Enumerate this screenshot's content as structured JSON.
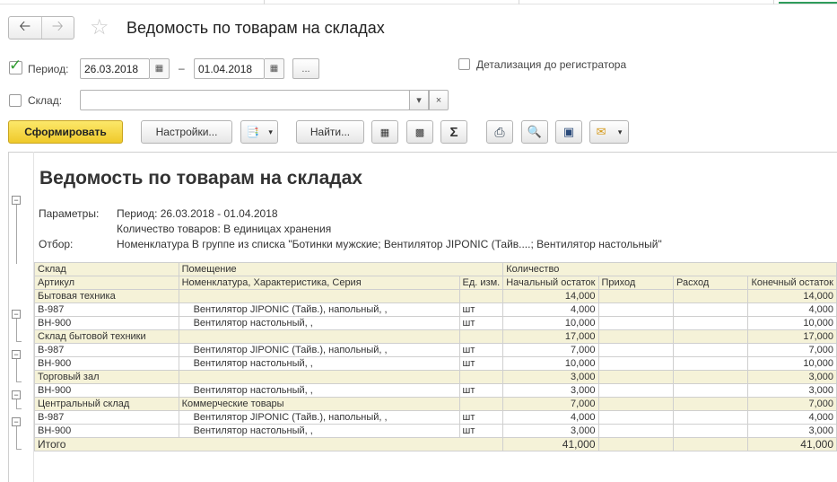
{
  "window": {
    "title": "Ведомость по товарам на складах",
    "back_icon": "arrow-left-icon",
    "forward_icon": "arrow-right-icon",
    "favorite_icon": "star-icon"
  },
  "filters": {
    "period_label": "Период:",
    "period_from": "26.03.2018",
    "period_dash": "–",
    "period_to": "01.04.2018",
    "period_more": "...",
    "detail_label": "Детализация до регистратора",
    "warehouse_label": "Склад:",
    "warehouse_value": ""
  },
  "toolbar": {
    "generate": "Сформировать",
    "settings": "Настройки...",
    "find": "Найти..."
  },
  "report": {
    "title": "Ведомость по товарам на складах",
    "params_label": "Параметры:",
    "params_line1": "Период: 26.03.2018 - 01.04.2018",
    "params_line2": "Количество товаров: В единицах хранения",
    "filter_label": "Отбор:",
    "filter_value": "Номенклатура В группе из списка \"Ботинки мужские; Вентилятор JIPONIC (Тайв....; Вентилятор настольный\"",
    "headers": {
      "warehouse": "Склад",
      "room": "Помещение",
      "quantity": "Количество",
      "article": "Артикул",
      "nomenclature": "Номенклатура, Характеристика, Серия",
      "unit": "Ед. изм.",
      "opening": "Начальный остаток",
      "income": "Приход",
      "expense": "Расход",
      "closing": "Конечный остаток"
    },
    "rows": [
      {
        "type": "group",
        "a": "Бытовая техника",
        "b": "",
        "c": "",
        "d": "14,000",
        "e": "",
        "f": "",
        "g": "14,000"
      },
      {
        "type": "item",
        "a": "В-987",
        "b": "Вентилятор JIPONIC (Тайв.), напольный, ,",
        "c": "шт",
        "d": "4,000",
        "e": "",
        "f": "",
        "g": "4,000"
      },
      {
        "type": "item",
        "a": "ВН-900",
        "b": "Вентилятор настольный, ,",
        "c": "шт",
        "d": "10,000",
        "e": "",
        "f": "",
        "g": "10,000"
      },
      {
        "type": "group",
        "a": "Склад бытовой техники",
        "b": "",
        "c": "",
        "d": "17,000",
        "e": "",
        "f": "",
        "g": "17,000"
      },
      {
        "type": "item",
        "a": "В-987",
        "b": "Вентилятор JIPONIC (Тайв.), напольный, ,",
        "c": "шт",
        "d": "7,000",
        "e": "",
        "f": "",
        "g": "7,000"
      },
      {
        "type": "item",
        "a": "ВН-900",
        "b": "Вентилятор настольный, ,",
        "c": "шт",
        "d": "10,000",
        "e": "",
        "f": "",
        "g": "10,000"
      },
      {
        "type": "group",
        "a": "Торговый зал",
        "b": "",
        "c": "",
        "d": "3,000",
        "e": "",
        "f": "",
        "g": "3,000"
      },
      {
        "type": "item",
        "a": "ВН-900",
        "b": "Вентилятор настольный, ,",
        "c": "шт",
        "d": "3,000",
        "e": "",
        "f": "",
        "g": "3,000"
      },
      {
        "type": "group",
        "a": "Центральный склад",
        "b": "Коммерческие товары",
        "c": "",
        "d": "7,000",
        "e": "",
        "f": "",
        "g": "7,000"
      },
      {
        "type": "item",
        "a": "В-987",
        "b": "Вентилятор JIPONIC (Тайв.), напольный, ,",
        "c": "шт",
        "d": "4,000",
        "e": "",
        "f": "",
        "g": "4,000"
      },
      {
        "type": "item",
        "a": "ВН-900",
        "b": "Вентилятор настольный, ,",
        "c": "шт",
        "d": "3,000",
        "e": "",
        "f": "",
        "g": "3,000"
      }
    ],
    "total": {
      "a": "Итого",
      "d": "41,000",
      "g": "41,000"
    }
  }
}
